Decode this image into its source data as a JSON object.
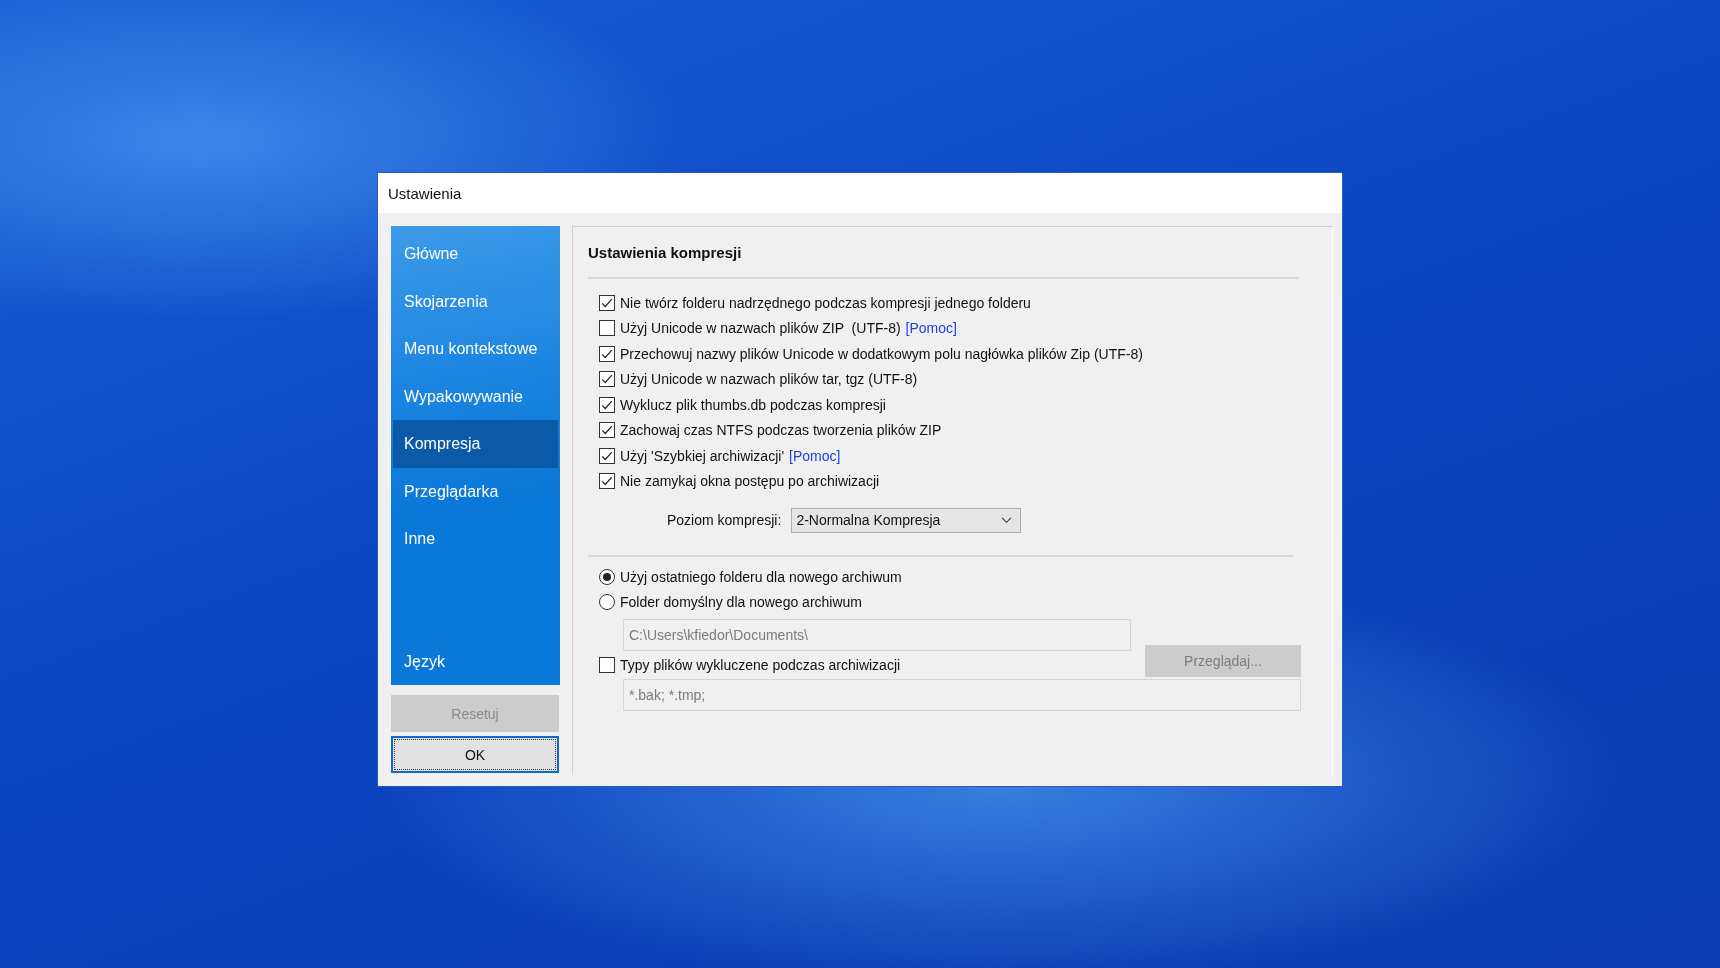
{
  "window": {
    "title": "Ustawienia"
  },
  "sidebar": {
    "items": [
      {
        "label": "Główne",
        "selected": false
      },
      {
        "label": "Skojarzenia",
        "selected": false
      },
      {
        "label": "Menu kontekstowe",
        "selected": false
      },
      {
        "label": "Wypakowywanie",
        "selected": false
      },
      {
        "label": "Kompresja",
        "selected": true
      },
      {
        "label": "Przeglądarka",
        "selected": false
      },
      {
        "label": "Inne",
        "selected": false
      }
    ],
    "bottom_items": [
      {
        "label": "Język",
        "selected": false
      }
    ]
  },
  "buttons": [
    {
      "label": "Resetuj",
      "disabled": true,
      "focused": false
    },
    {
      "label": "OK",
      "disabled": false,
      "focused": true
    }
  ],
  "panel": {
    "title": "Ustawienia kompresji",
    "options": [
      {
        "label": "Nie twórz folderu nadrzędnego podczas kompresji jednego folderu",
        "checked": true
      },
      {
        "label": "Użyj Unicode w nazwach plików ZIP  (UTF-8)",
        "link": "[Pomoc]",
        "checked": false
      },
      {
        "label": "Przechowuj nazwy plików Unicode w dodatkowym polu nagłówka plików Zip (UTF-8)",
        "checked": true
      },
      {
        "label": "Użyj Unicode w nazwach plików tar, tgz (UTF-8)",
        "checked": true
      },
      {
        "label": "Wyklucz plik thumbs.db podczas kompresji",
        "checked": true
      },
      {
        "label": "Zachowaj czas NTFS podczas tworzenia plików ZIP",
        "checked": true
      },
      {
        "label": "Użyj 'Szybkiej archiwizacji'",
        "link": "[Pomoc]",
        "checked": true
      },
      {
        "label": "Nie zamykaj okna postępu po archiwizacji",
        "checked": true
      }
    ],
    "level": {
      "label": "Poziom kompresji:",
      "value": "2-Normalna Kompresja"
    },
    "folder_options": [
      {
        "label": "Użyj ostatniego folderu dla nowego archiwum",
        "selected": true
      },
      {
        "label": "Folder domyślny dla nowego archiwum",
        "selected": false
      }
    ],
    "default_folder": {
      "value": "C:\\Users\\kfiedor\\Documents\\",
      "disabled": true
    },
    "browse_button": {
      "label": "Przeglądaj...",
      "disabled": true
    },
    "exclude": {
      "label": "Typy plików wykluczene podczas archiwizacji",
      "checked": false
    },
    "exclude_field": {
      "value": "*.bak; *.tmp;",
      "disabled": true
    }
  }
}
